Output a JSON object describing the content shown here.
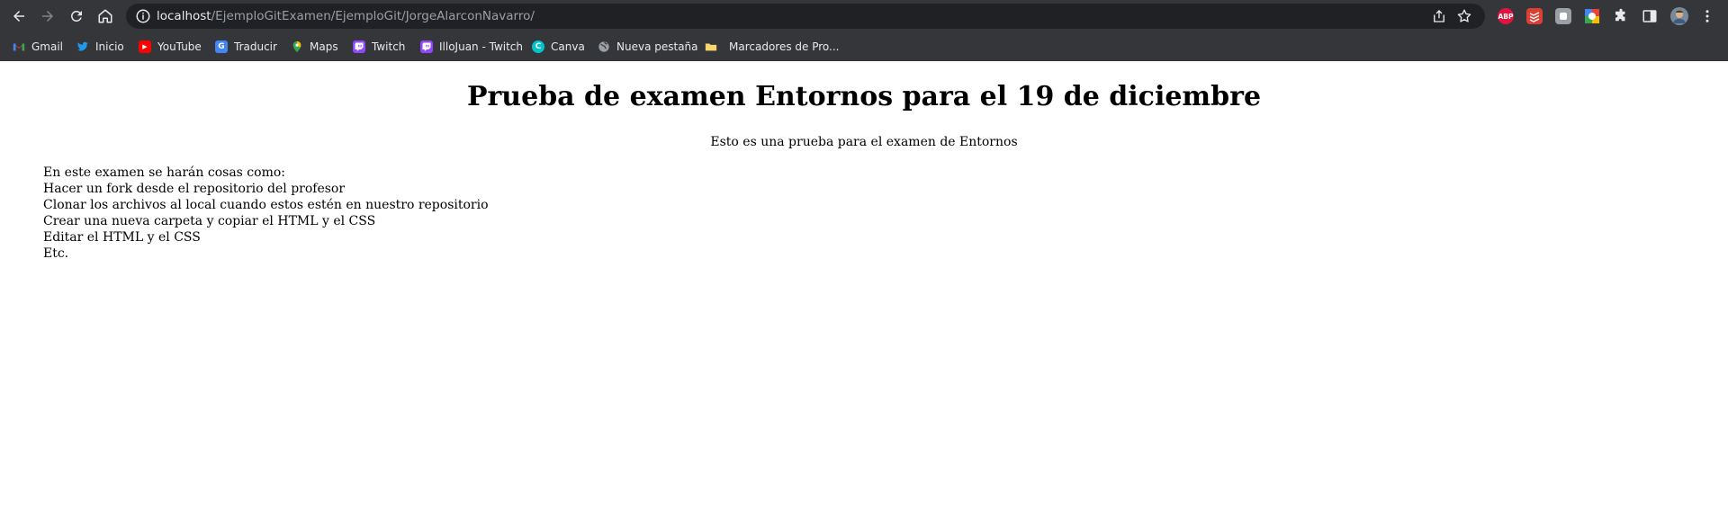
{
  "browser": {
    "url_host": "localhost",
    "url_path": "/EjemploGitExamen/EjemploGit/JorgeAlarconNavarro/",
    "extensions": [
      {
        "name": "adblock-plus-icon",
        "text": "ABP",
        "color": "#e0143c"
      },
      {
        "name": "todoist-icon",
        "text": "",
        "color": "#db4035"
      },
      {
        "name": "extension-gray-icon",
        "text": "",
        "color": "#9aa0a6"
      },
      {
        "name": "google-extension-icon",
        "text": "",
        "color": "#4285f4"
      },
      {
        "name": "extensions-puzzle-icon",
        "text": "",
        "color": ""
      },
      {
        "name": "side-panel-icon",
        "text": "",
        "color": ""
      },
      {
        "name": "profile-avatar-icon",
        "text": "",
        "color": "#7a8a9a"
      },
      {
        "name": "menu-kebab-icon",
        "text": "",
        "color": ""
      }
    ],
    "bookmarks": [
      {
        "label": "Gmail",
        "icon": "gmail-icon",
        "color": "#ea4335",
        "glyph": "M"
      },
      {
        "label": "Inicio",
        "icon": "twitter-icon",
        "color": "#1d9bf0",
        "glyph": ""
      },
      {
        "label": "YouTube",
        "icon": "youtube-icon",
        "color": "#ff0000",
        "glyph": "▶"
      },
      {
        "label": "Traducir",
        "icon": "google-translate-icon",
        "color": "#4285f4",
        "glyph": "G"
      },
      {
        "label": "Maps",
        "icon": "google-maps-icon",
        "color": "#34a853",
        "glyph": ""
      },
      {
        "label": "Twitch",
        "icon": "twitch-icon",
        "color": "#9146ff",
        "glyph": ""
      },
      {
        "label": "IlloJuan - Twitch",
        "icon": "twitch-icon",
        "color": "#9146ff",
        "glyph": ""
      },
      {
        "label": "Canva",
        "icon": "canva-icon",
        "color": "#00c4cc",
        "glyph": "C"
      },
      {
        "label": "Nueva pestaña",
        "icon": "globe-icon",
        "color": "#9aa0a6",
        "glyph": ""
      },
      {
        "label": "Marcadores de Pro...",
        "icon": "folder-icon",
        "color": "#f9d56e",
        "glyph": ""
      }
    ]
  },
  "page": {
    "heading": "Prueba de examen Entornos para el 19 de diciembre",
    "subtitle": "Esto es una prueba para el examen de Entornos",
    "lines": [
      "En este examen se harán cosas como:",
      "Hacer un fork desde el repositorio del profesor",
      "Clonar los archivos al local cuando estos estén en nuestro repositorio",
      "Crear una nueva carpeta y copiar el HTML y el CSS",
      "Editar el HTML y el CSS",
      "Etc."
    ]
  }
}
